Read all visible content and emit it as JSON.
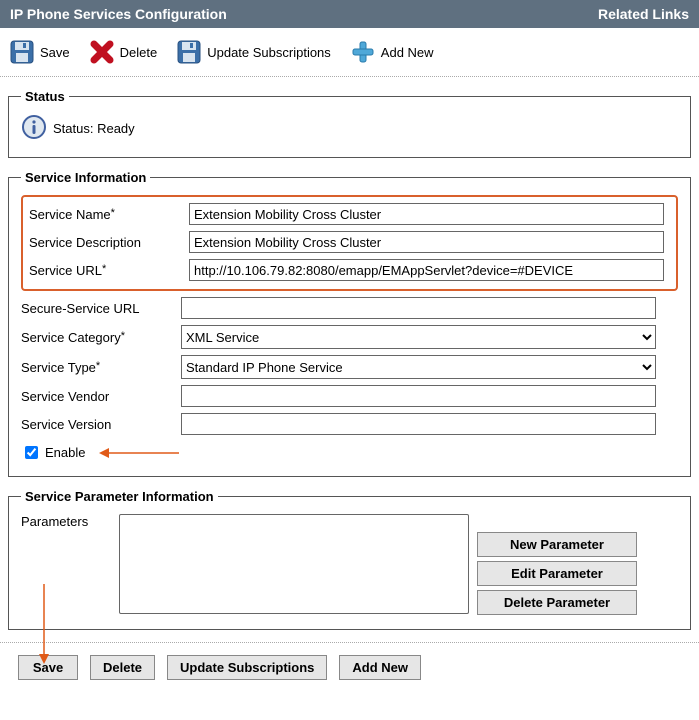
{
  "header": {
    "title": "IP Phone Services Configuration",
    "related": "Related Links"
  },
  "toolbar": {
    "save": "Save",
    "delete": "Delete",
    "update": "Update Subscriptions",
    "addnew": "Add New"
  },
  "status": {
    "legend": "Status",
    "text": "Status: Ready"
  },
  "serviceInfo": {
    "legend": "Service Information",
    "labels": {
      "name": "Service Name",
      "desc": "Service Description",
      "url": "Service URL",
      "secure": "Secure-Service URL",
      "category": "Service Category",
      "type": "Service Type",
      "vendor": "Service Vendor",
      "version": "Service Version",
      "enable": "Enable"
    },
    "values": {
      "name": "Extension Mobility Cross Cluster",
      "desc": "Extension Mobility Cross Cluster",
      "url": "http://10.106.79.82:8080/emapp/EMAppServlet?device=#DEVICE",
      "secure": "",
      "category": "XML Service",
      "type": "Standard IP Phone Service",
      "vendor": "",
      "version": "",
      "enable_checked": true
    }
  },
  "paramInfo": {
    "legend": "Service Parameter Information",
    "label": "Parameters",
    "buttons": {
      "new": "New Parameter",
      "edit": "Edit Parameter",
      "delete": "Delete Parameter"
    }
  },
  "footer": {
    "save": "Save",
    "delete": "Delete",
    "update": "Update Subscriptions",
    "addnew": "Add New"
  }
}
